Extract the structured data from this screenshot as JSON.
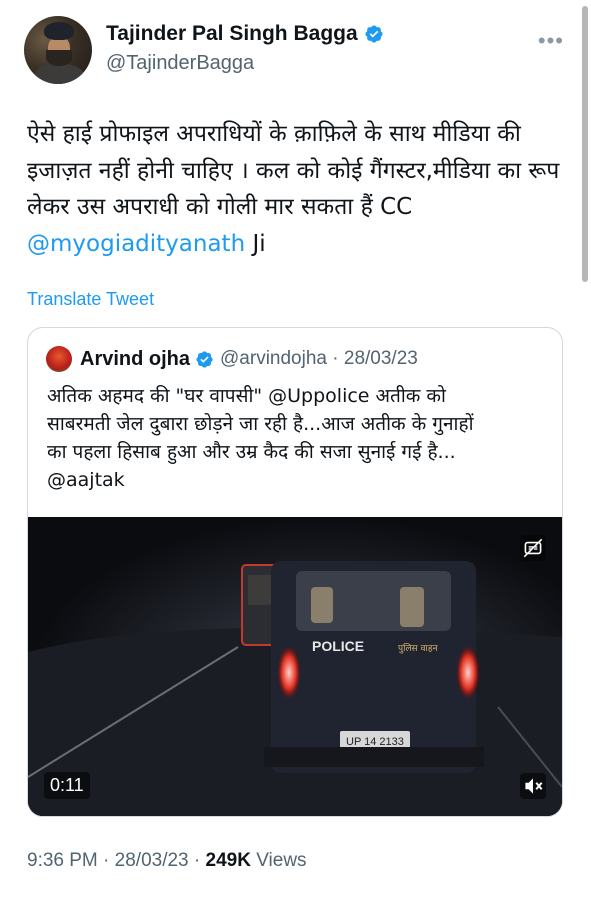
{
  "tweet": {
    "author_name": "Tajinder Pal Singh Bagga",
    "author_handle": "@TajinderBagga",
    "more_label": "•••",
    "text": "ऐसे हाई प्रोफाइल अपराधियों के क़ाफ़िले के साथ मीडिया की इजाज़त नहीं होनी चाहिए । कल को कोई गैंगस्टर,मीडिया का रूप लेकर उस अपराधी को गोली मार सकता हैं CC",
    "mention": "@myogiadityanath",
    "text_suffix": " Ji",
    "translate_label": "Translate Tweet",
    "time": "9:36 PM",
    "date": "28/03/23",
    "views_count": "249K",
    "views_label": "Views",
    "sep": " · ",
    "icons": {
      "verified": "verified-badge-icon",
      "more": "more-icon"
    },
    "colors": {
      "accent": "#1d9bf0",
      "secondary_text": "#536471"
    }
  },
  "quote": {
    "author_name": "Arvind ojha",
    "author_handle": "@arvindojha",
    "date": "28/03/23",
    "text_line1": "अतिक अहमद की \"घर वापसी\" @Uppolice अतीक को",
    "text_line2": "साबरमती जेल दुबारा छोड़ने जा रही है...आज अतीक के गुनाहों",
    "text_line3": "का पहला हिसाब हुआ और उम्र कैद की सजा सुनाई गई है...",
    "text_line4": "@aajtak",
    "video": {
      "duration": "0:11",
      "vehicle_label": "POLICE",
      "vehicle_label_hindi": "पुलिस वाहन",
      "plate": "UP 14 2133",
      "icons": {
        "captions": "captions-off-icon",
        "mute": "muted-speaker-icon"
      }
    }
  }
}
